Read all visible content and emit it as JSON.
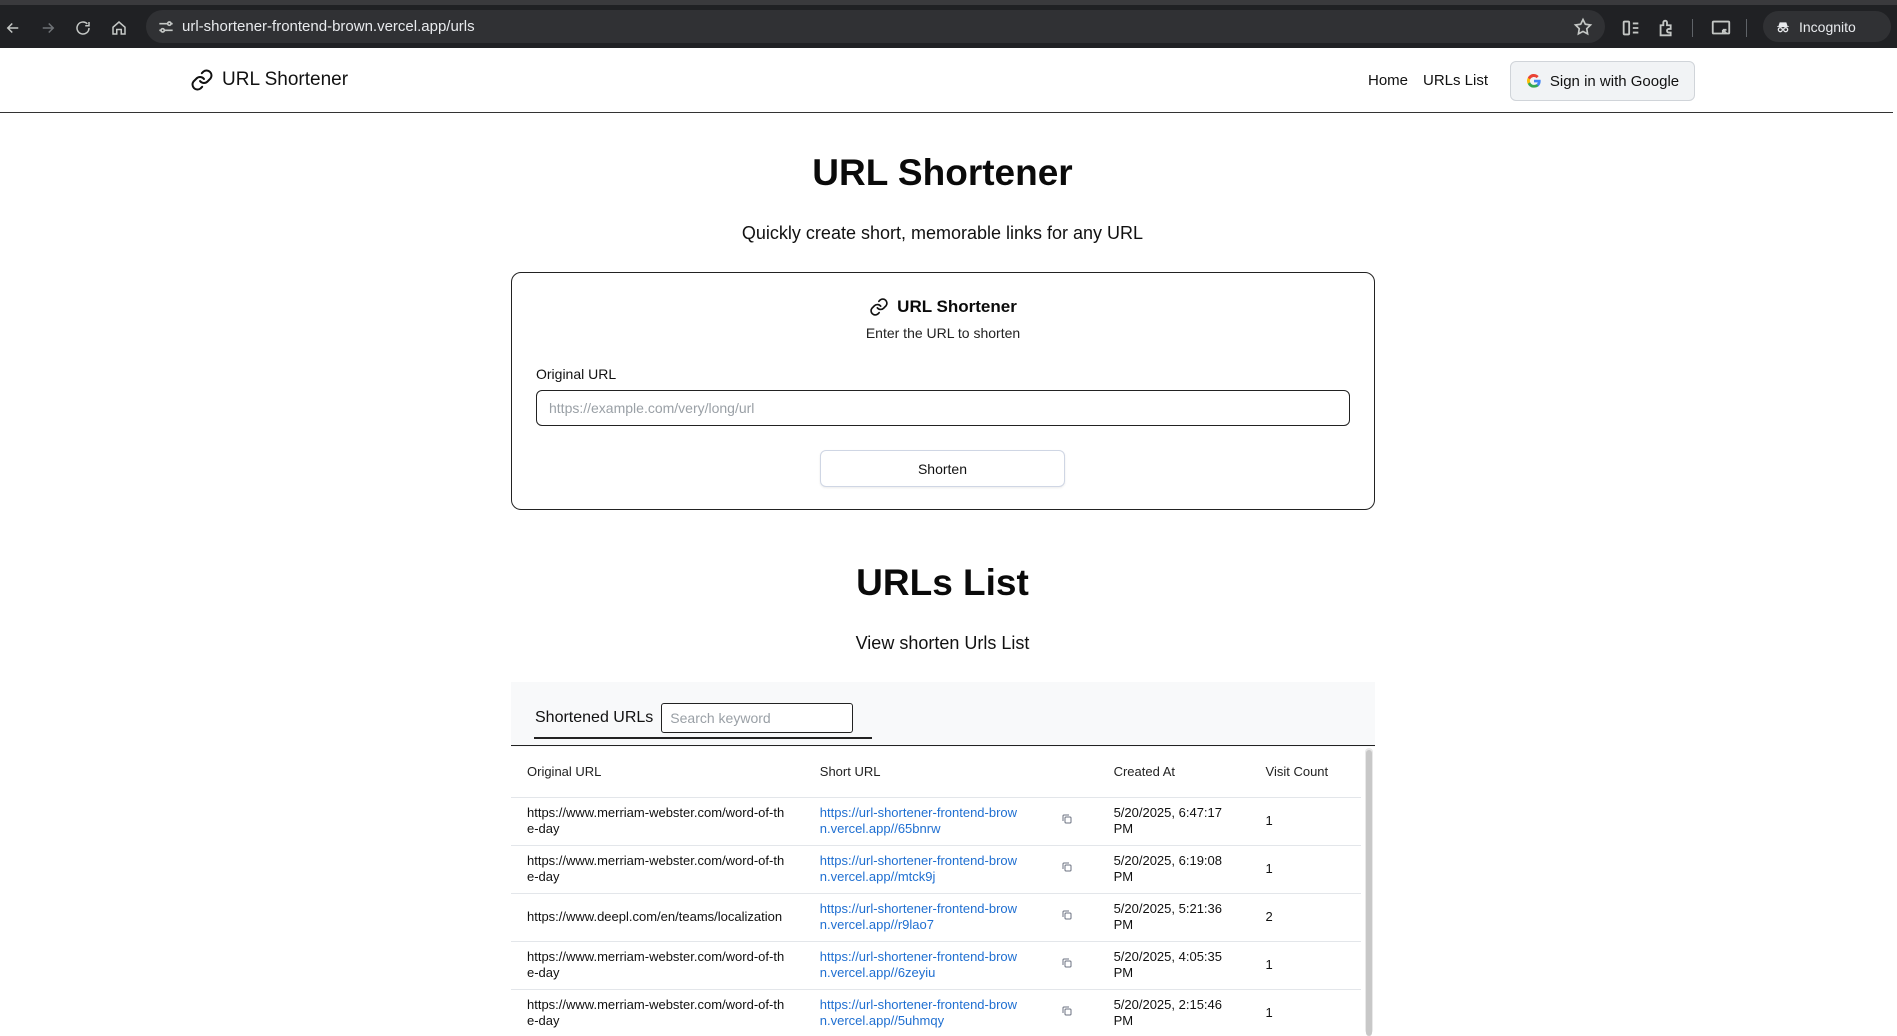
{
  "browser": {
    "url": "url-shortener-frontend-brown.vercel.app/urls",
    "profile_label": "Incognito"
  },
  "header": {
    "brand": "URL Shortener",
    "nav": [
      "Home",
      "URLs List"
    ],
    "signin_label": "Sign in with Google"
  },
  "hero": {
    "title": "URL Shortener",
    "subtitle": "Quickly create short, memorable links for any URL"
  },
  "card": {
    "title": "URL Shortener",
    "description": "Enter the URL to shorten",
    "field_label": "Original URL",
    "placeholder": "https://example.com/very/long/url",
    "button": "Shorten"
  },
  "list": {
    "title": "URLs List",
    "subtitle": "View shorten Urls List",
    "tab_label": "Shortened URLs",
    "search_placeholder": "Search keyword",
    "columns": [
      "Original URL",
      "Short URL",
      "Created At",
      "Visit Count"
    ],
    "rows": [
      {
        "original": "https://www.merriam-webster.com/word-of-the-day",
        "short": "https://url-shortener-frontend-brown.vercel.app//65bnrw",
        "created": "5/20/2025, 6:47:17 PM",
        "visits": "1"
      },
      {
        "original": "https://www.merriam-webster.com/word-of-the-day",
        "short": "https://url-shortener-frontend-brown.vercel.app//mtck9j",
        "created": "5/20/2025, 6:19:08 PM",
        "visits": "1"
      },
      {
        "original": "https://www.deepl.com/en/teams/localization",
        "short": "https://url-shortener-frontend-brown.vercel.app//r9lao7",
        "created": "5/20/2025, 5:21:36 PM",
        "visits": "2"
      },
      {
        "original": "https://www.merriam-webster.com/word-of-the-day",
        "short": "https://url-shortener-frontend-brown.vercel.app//6zeyiu",
        "created": "5/20/2025, 4:05:35 PM",
        "visits": "1"
      },
      {
        "original": "https://www.merriam-webster.com/word-of-the-day",
        "short": "https://url-shortener-frontend-brown.vercel.app//5uhmqy",
        "created": "5/20/2025, 2:15:46 PM",
        "visits": "1"
      }
    ]
  },
  "colors": {
    "link": "#1f6fd1",
    "chrome_bg": "#202124"
  }
}
